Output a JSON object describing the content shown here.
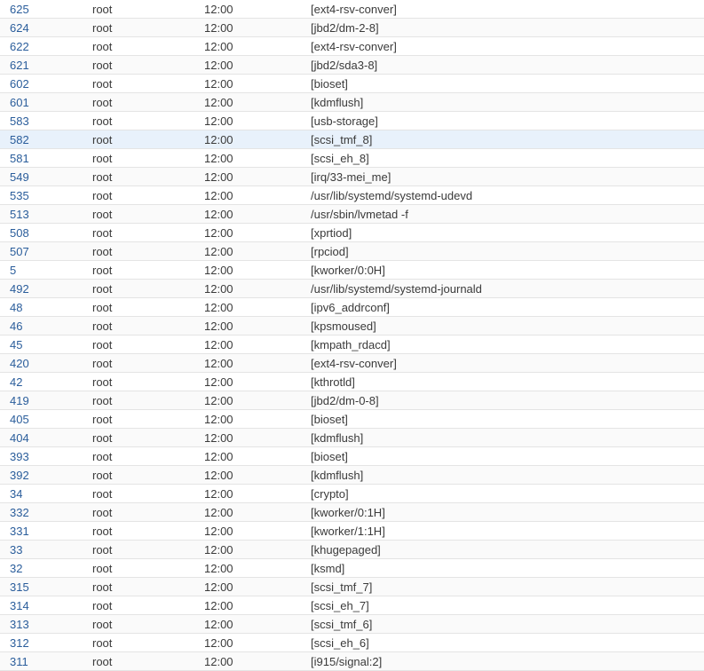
{
  "process_list": {
    "highlighted_pid": "582",
    "rows": [
      {
        "pid": "625",
        "user": "root",
        "time": "12:00",
        "command": "[ext4-rsv-conver]"
      },
      {
        "pid": "624",
        "user": "root",
        "time": "12:00",
        "command": "[jbd2/dm-2-8]"
      },
      {
        "pid": "622",
        "user": "root",
        "time": "12:00",
        "command": "[ext4-rsv-conver]"
      },
      {
        "pid": "621",
        "user": "root",
        "time": "12:00",
        "command": "[jbd2/sda3-8]"
      },
      {
        "pid": "602",
        "user": "root",
        "time": "12:00",
        "command": "[bioset]"
      },
      {
        "pid": "601",
        "user": "root",
        "time": "12:00",
        "command": "[kdmflush]"
      },
      {
        "pid": "583",
        "user": "root",
        "time": "12:00",
        "command": "[usb-storage]"
      },
      {
        "pid": "582",
        "user": "root",
        "time": "12:00",
        "command": "[scsi_tmf_8]"
      },
      {
        "pid": "581",
        "user": "root",
        "time": "12:00",
        "command": "[scsi_eh_8]"
      },
      {
        "pid": "549",
        "user": "root",
        "time": "12:00",
        "command": "[irq/33-mei_me]"
      },
      {
        "pid": "535",
        "user": "root",
        "time": "12:00",
        "command": "/usr/lib/systemd/systemd-udevd"
      },
      {
        "pid": "513",
        "user": "root",
        "time": "12:00",
        "command": "/usr/sbin/lvmetad -f"
      },
      {
        "pid": "508",
        "user": "root",
        "time": "12:00",
        "command": "[xprtiod]"
      },
      {
        "pid": "507",
        "user": "root",
        "time": "12:00",
        "command": "[rpciod]"
      },
      {
        "pid": "5",
        "user": "root",
        "time": "12:00",
        "command": "[kworker/0:0H]"
      },
      {
        "pid": "492",
        "user": "root",
        "time": "12:00",
        "command": "/usr/lib/systemd/systemd-journald"
      },
      {
        "pid": "48",
        "user": "root",
        "time": "12:00",
        "command": "[ipv6_addrconf]"
      },
      {
        "pid": "46",
        "user": "root",
        "time": "12:00",
        "command": "[kpsmoused]"
      },
      {
        "pid": "45",
        "user": "root",
        "time": "12:00",
        "command": "[kmpath_rdacd]"
      },
      {
        "pid": "420",
        "user": "root",
        "time": "12:00",
        "command": "[ext4-rsv-conver]"
      },
      {
        "pid": "42",
        "user": "root",
        "time": "12:00",
        "command": "[kthrotld]"
      },
      {
        "pid": "419",
        "user": "root",
        "time": "12:00",
        "command": "[jbd2/dm-0-8]"
      },
      {
        "pid": "405",
        "user": "root",
        "time": "12:00",
        "command": "[bioset]"
      },
      {
        "pid": "404",
        "user": "root",
        "time": "12:00",
        "command": "[kdmflush]"
      },
      {
        "pid": "393",
        "user": "root",
        "time": "12:00",
        "command": "[bioset]"
      },
      {
        "pid": "392",
        "user": "root",
        "time": "12:00",
        "command": "[kdmflush]"
      },
      {
        "pid": "34",
        "user": "root",
        "time": "12:00",
        "command": "[crypto]"
      },
      {
        "pid": "332",
        "user": "root",
        "time": "12:00",
        "command": "[kworker/0:1H]"
      },
      {
        "pid": "331",
        "user": "root",
        "time": "12:00",
        "command": "[kworker/1:1H]"
      },
      {
        "pid": "33",
        "user": "root",
        "time": "12:00",
        "command": "[khugepaged]"
      },
      {
        "pid": "32",
        "user": "root",
        "time": "12:00",
        "command": "[ksmd]"
      },
      {
        "pid": "315",
        "user": "root",
        "time": "12:00",
        "command": "[scsi_tmf_7]"
      },
      {
        "pid": "314",
        "user": "root",
        "time": "12:00",
        "command": "[scsi_eh_7]"
      },
      {
        "pid": "313",
        "user": "root",
        "time": "12:00",
        "command": "[scsi_tmf_6]"
      },
      {
        "pid": "312",
        "user": "root",
        "time": "12:00",
        "command": "[scsi_eh_6]"
      },
      {
        "pid": "311",
        "user": "root",
        "time": "12:00",
        "command": "[i915/signal:2]"
      }
    ]
  }
}
